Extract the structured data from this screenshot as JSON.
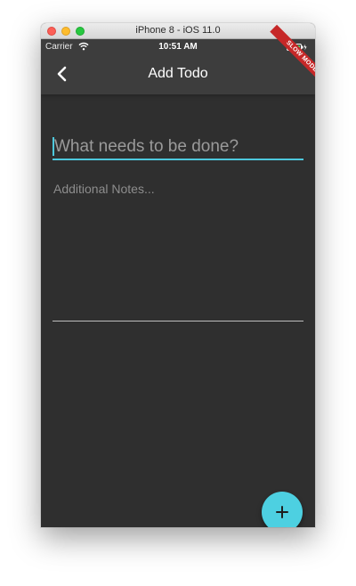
{
  "window": {
    "title": "iPhone 8 - iOS 11.0"
  },
  "status_bar": {
    "carrier": "Carrier",
    "time": "10:51 AM",
    "wifi_icon": "wifi-icon",
    "battery_icon": "battery-charging-icon",
    "debug_banner": "SLOW MODE"
  },
  "app_bar": {
    "title": "Add Todo",
    "back_icon": "chevron-left-icon"
  },
  "form": {
    "task_placeholder": "What needs to be done?",
    "notes_placeholder": "Additional Notes..."
  },
  "fab": {
    "icon": "plus-icon"
  },
  "colors": {
    "accent": "#4dc8dc",
    "background": "#2f2f2f",
    "app_bar": "#3d3d3d",
    "banner": "#c62828"
  }
}
